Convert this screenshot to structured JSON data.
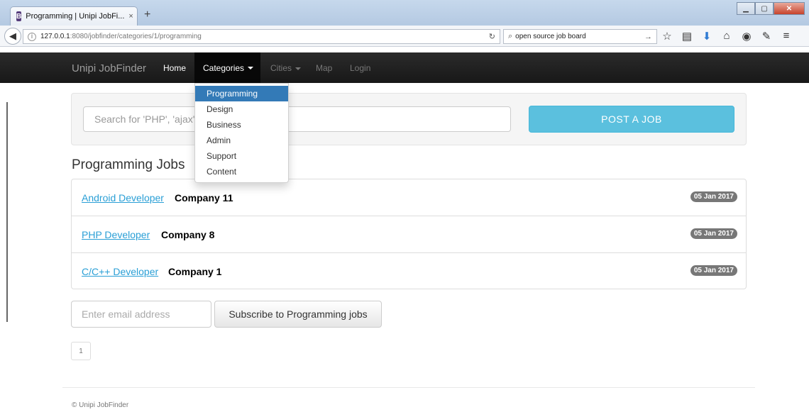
{
  "browser": {
    "tab_title": "Programming | Unipi JobFi...",
    "tab_favicon": "B",
    "tab_close": "×",
    "new_tab": "+",
    "url_host": "127.0.0.1",
    "url_rest": ":8080/jobfinder/categories/1/programming",
    "search_text": "open source job board",
    "icons": [
      "back-arrow-icon",
      "info-icon",
      "reload-icon",
      "search-icon",
      "arrow-right-icon",
      "star-icon",
      "bookmarks-icon",
      "download-icon",
      "home-icon",
      "adblock-icon",
      "tools-icon",
      "menu-icon"
    ]
  },
  "nav": {
    "brand": "Unipi JobFinder",
    "home": "Home",
    "categories": "Categories",
    "cities": "Cities",
    "map": "Map",
    "login": "Login"
  },
  "dropdown": {
    "items": [
      "Programming",
      "Design",
      "Business",
      "Admin",
      "Support",
      "Content"
    ],
    "active_index": 0
  },
  "search": {
    "placeholder": "Search for 'PHP', 'ajax'",
    "post_button": "POST A JOB"
  },
  "jobs": {
    "title": "Programming Jobs",
    "items": [
      {
        "title": "Android Developer",
        "company": "Company 11",
        "date": "05 Jan 2017"
      },
      {
        "title": "PHP Developer",
        "company": "Company 8",
        "date": "05 Jan 2017"
      },
      {
        "title": "C/C++ Developer",
        "company": "Company 1",
        "date": "05 Jan 2017"
      }
    ]
  },
  "subscribe": {
    "placeholder": "Enter email address",
    "button": "Subscribe to Programming jobs"
  },
  "pagination": {
    "current": "1"
  },
  "footer": {
    "text": "© Unipi JobFinder"
  },
  "colors": {
    "accent": "#5bc0de",
    "link": "#2a9fd6",
    "navbar": "#222222",
    "dropdown_active": "#337ab7"
  }
}
